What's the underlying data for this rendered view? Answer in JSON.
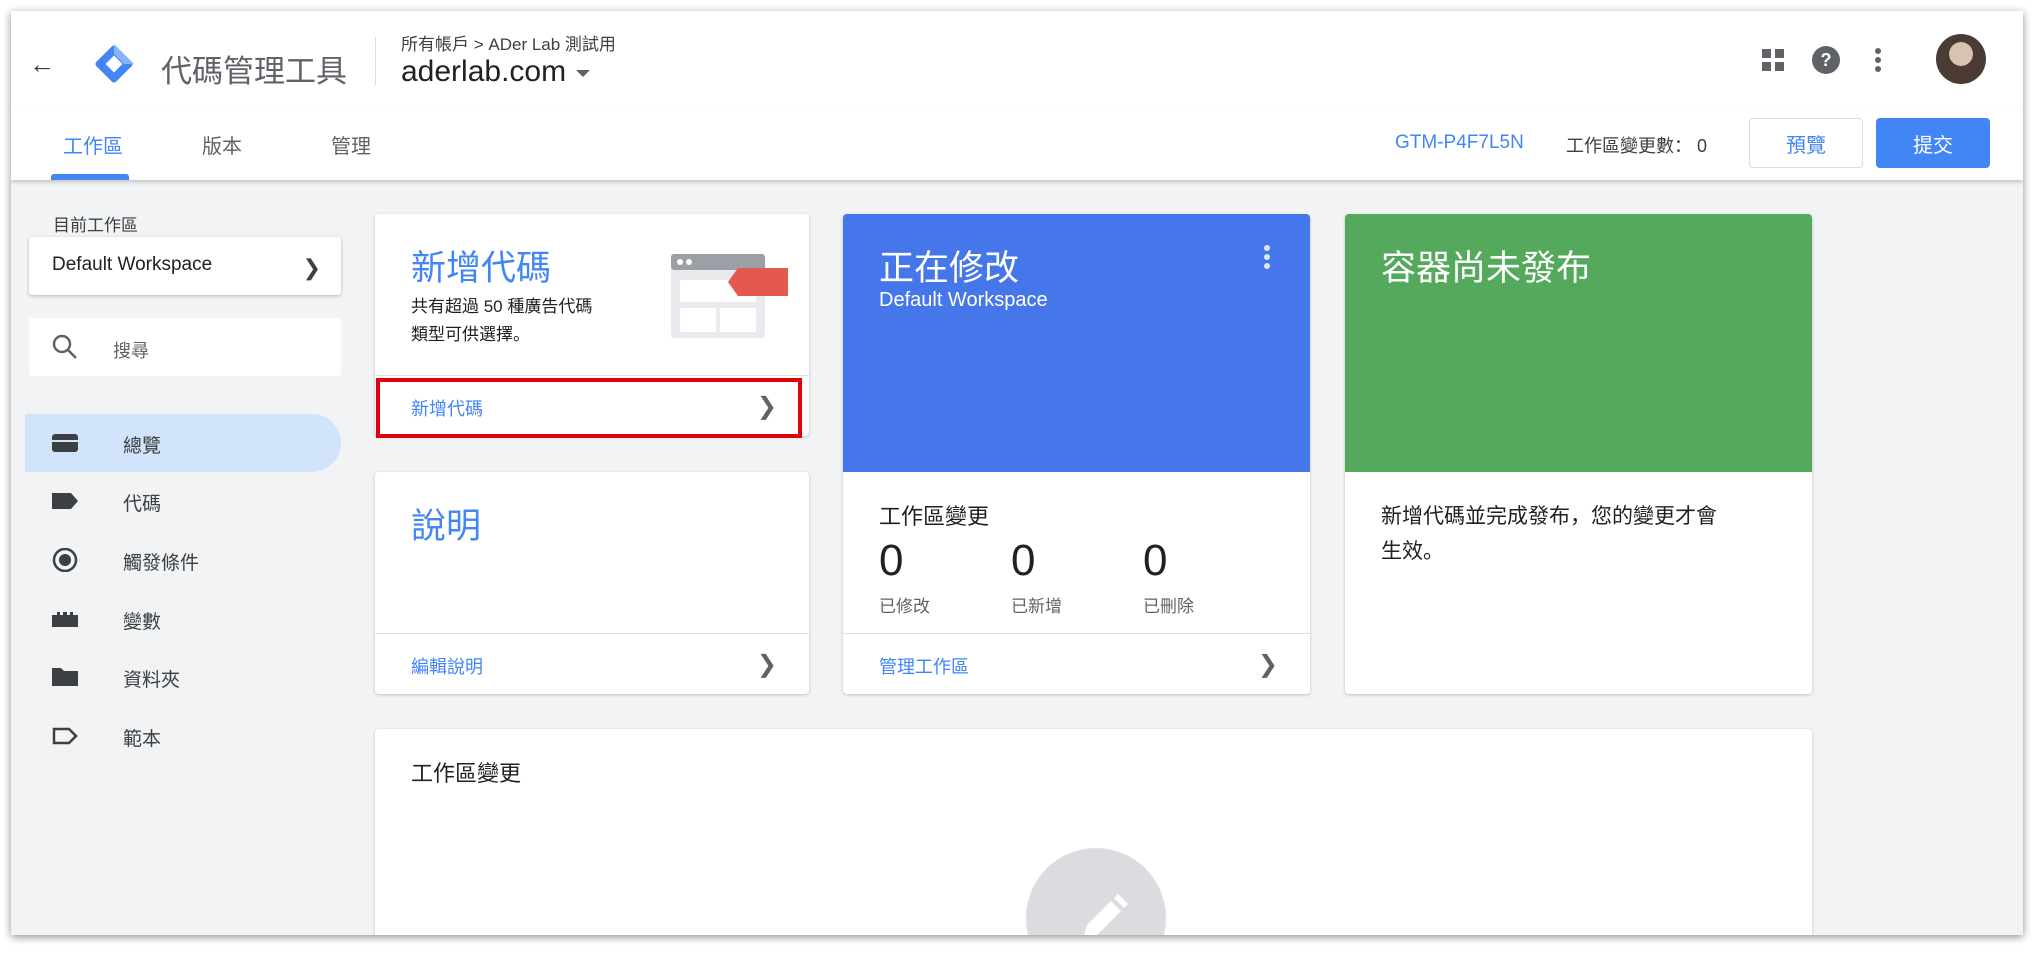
{
  "header": {
    "back_icon": "arrow-back-icon",
    "app_name": "代碼管理工具",
    "breadcrumb": "所有帳戶 > ADer Lab 測試用",
    "account": "aderlab.com"
  },
  "tabs": [
    {
      "label": "工作區",
      "active": true
    },
    {
      "label": "版本",
      "active": false
    },
    {
      "label": "管理",
      "active": false
    }
  ],
  "toolbar": {
    "container_id": "GTM-P4F7L5N",
    "workspace_changes": "工作區變更數： 0",
    "preview_label": "預覽",
    "submit_label": "提交"
  },
  "sidebar": {
    "current_workspace_label": "目前工作區",
    "workspace_name": "Default Workspace",
    "search_placeholder": "搜尋",
    "items": [
      {
        "label": "總覽",
        "icon": "overview-icon",
        "active": true
      },
      {
        "label": "代碼",
        "icon": "tag-icon",
        "active": false
      },
      {
        "label": "觸發條件",
        "icon": "trigger-icon",
        "active": false
      },
      {
        "label": "變數",
        "icon": "variable-icon",
        "active": false
      },
      {
        "label": "資料夾",
        "icon": "folder-icon",
        "active": false
      },
      {
        "label": "範本",
        "icon": "template-icon",
        "active": false
      }
    ]
  },
  "new_tag_card": {
    "title": "新增代碼",
    "description_line1": "共有超過 50 種廣告代碼",
    "description_line2": "類型可供選擇。",
    "link": "新增代碼"
  },
  "description_card": {
    "title": "說明",
    "link": "編輯說明"
  },
  "editing_card": {
    "title": "正在修改",
    "workspace": "Default Workspace",
    "changes_title": "工作區變更",
    "stats": [
      {
        "value": "0",
        "label": "已修改"
      },
      {
        "value": "0",
        "label": "已新增"
      },
      {
        "value": "0",
        "label": "已刪除"
      }
    ],
    "link": "管理工作區"
  },
  "publish_card": {
    "title": "容器尚未發布",
    "message_line1": "新增代碼並完成發布，您的變更才會",
    "message_line2": "生效。"
  },
  "workspace_changes_card": {
    "title": "工作區變更"
  },
  "colors": {
    "accent": "#4285f4",
    "editing_card": "#4677ea",
    "publish_card": "#55a95c",
    "highlight": "#e0000b"
  }
}
